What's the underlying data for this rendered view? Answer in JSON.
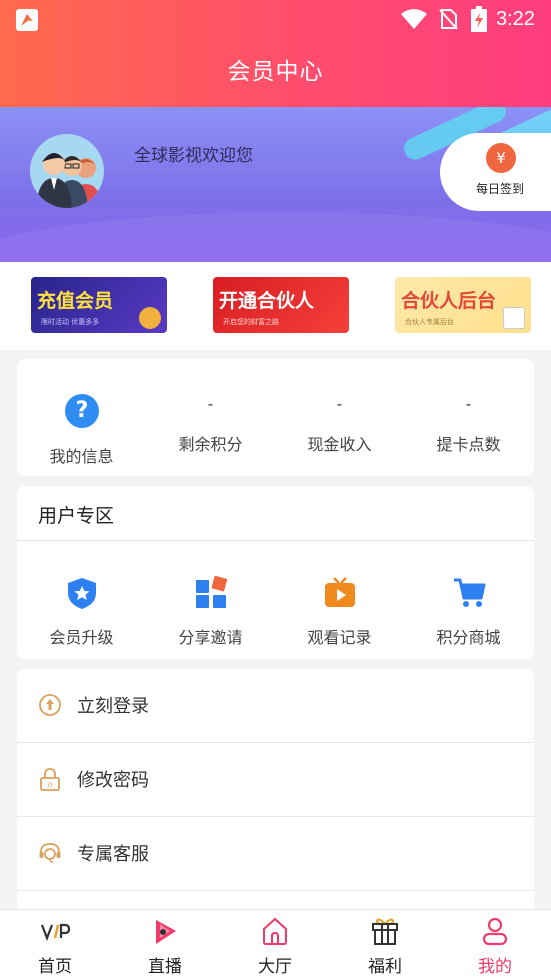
{
  "status_bar": {
    "time": "3:22"
  },
  "header": {
    "title": "会员中心"
  },
  "profile": {
    "welcome": "全球影视欢迎您",
    "checkin_label": "每日签到",
    "checkin_symbol": "¥"
  },
  "banners": [
    {
      "title": "充值会员",
      "subtitle": "限时活动 优惠多多"
    },
    {
      "title": "开通合伙人",
      "subtitle": "开启您的财富之路"
    },
    {
      "title": "合伙人后台",
      "subtitle": "合伙人专属后台"
    }
  ],
  "stats": [
    {
      "label": "我的信息",
      "icon": "question-icon"
    },
    {
      "label": "剩余积分",
      "value": "-"
    },
    {
      "label": "现金收入",
      "value": "-"
    },
    {
      "label": "提卡点数",
      "value": "-"
    }
  ],
  "user_zone": {
    "title": "用户专区",
    "items": [
      {
        "label": "会员升级",
        "icon": "shield-star-icon"
      },
      {
        "label": "分享邀请",
        "icon": "grid-icon"
      },
      {
        "label": "观看记录",
        "icon": "tv-play-icon"
      },
      {
        "label": "积分商城",
        "icon": "cart-icon"
      }
    ]
  },
  "menu": [
    {
      "label": "立刻登录",
      "icon": "login-icon"
    },
    {
      "label": "修改密码",
      "icon": "lock-icon"
    },
    {
      "label": "专属客服",
      "icon": "headset-icon"
    }
  ],
  "tabbar": [
    {
      "label": "首页",
      "icon": "vip-icon"
    },
    {
      "label": "直播",
      "icon": "live-icon"
    },
    {
      "label": "大厅",
      "icon": "home-icon"
    },
    {
      "label": "福利",
      "icon": "gift-icon"
    },
    {
      "label": "我的",
      "icon": "user-icon",
      "active": true
    }
  ],
  "colors": {
    "accent": "#f03a6a",
    "header_start": "#ff6a4d",
    "header_end": "#ff3d7f",
    "profile_bg": "#7d6fe9"
  }
}
